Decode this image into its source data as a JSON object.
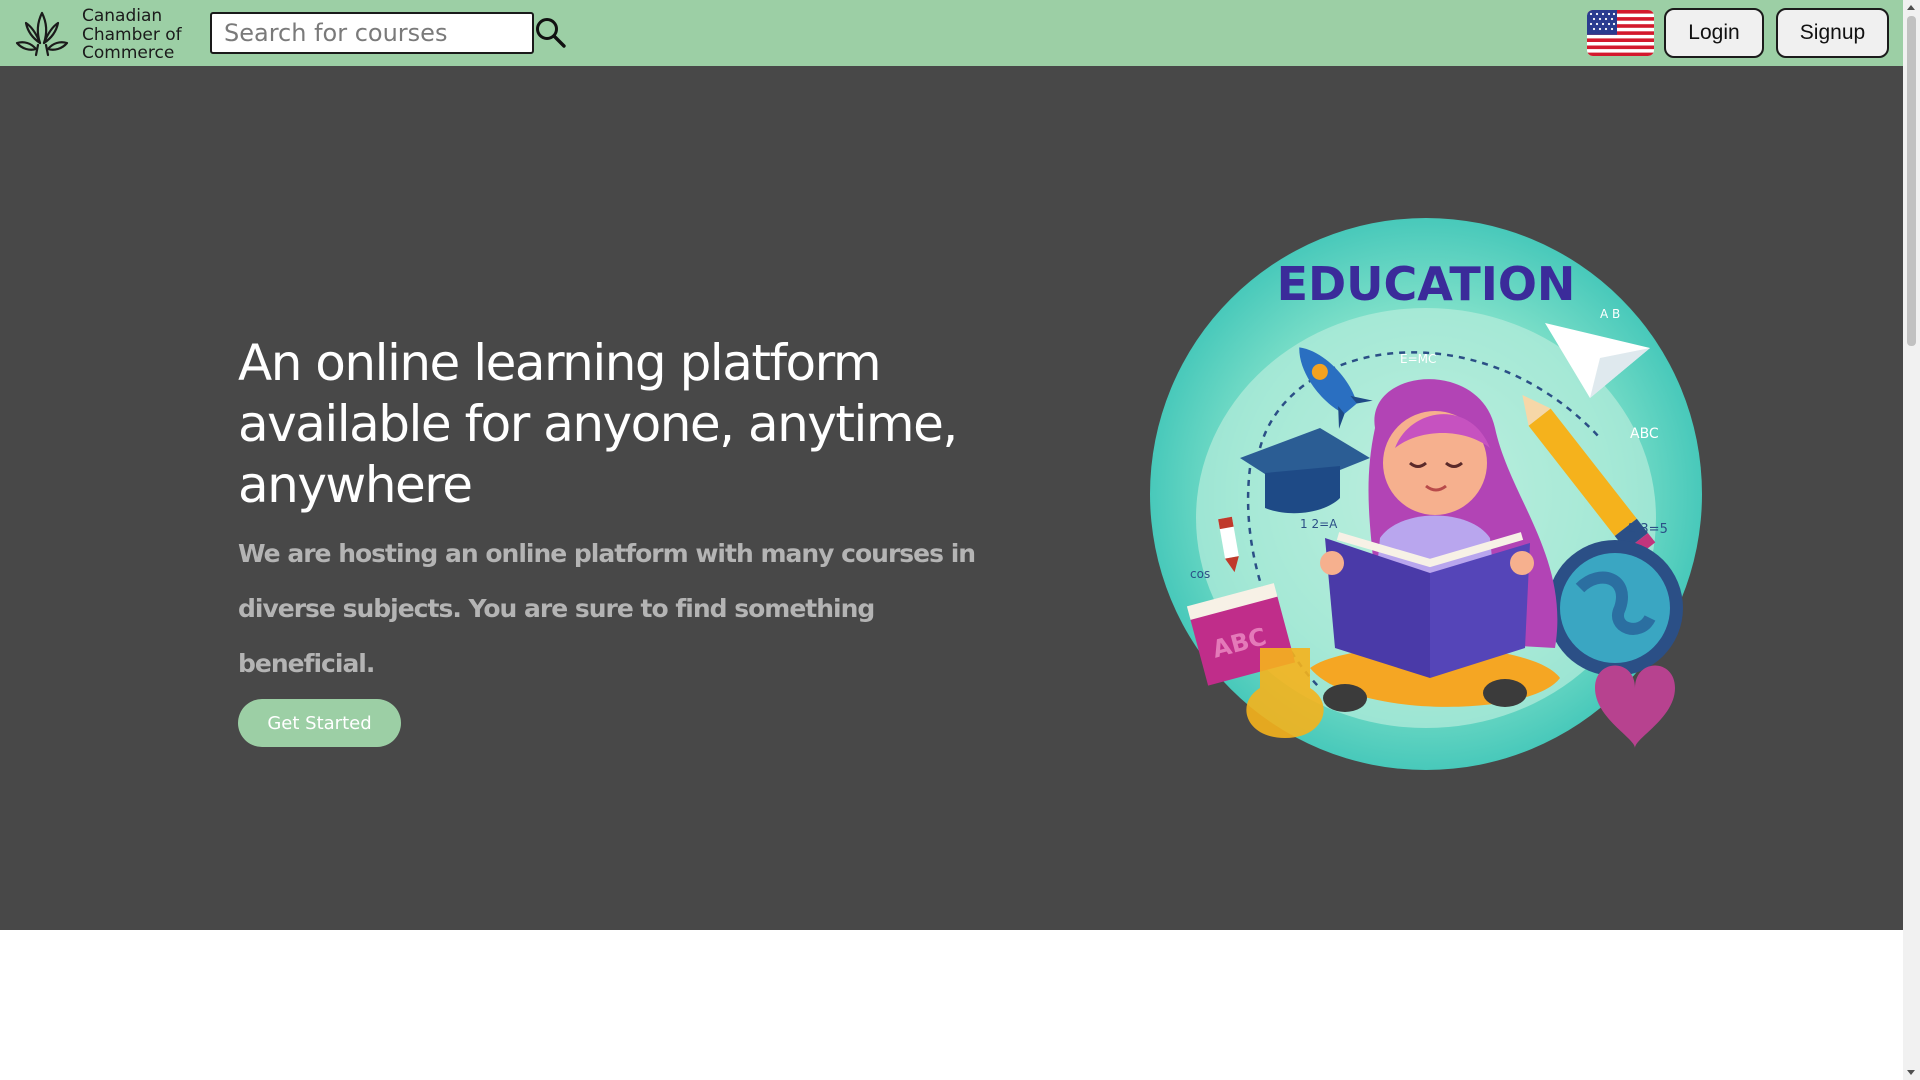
{
  "header": {
    "logo_lines": [
      "Canadian",
      "Chamber of",
      "Commerce"
    ],
    "logo_icon": "maple-leaf-icon",
    "search": {
      "placeholder": "Search for courses",
      "value": "",
      "icon": "search-icon"
    },
    "flag_icon": "us-flag-icon",
    "login_label": "Login",
    "signup_label": "Signup",
    "background_color": "#9ccfa5"
  },
  "hero": {
    "title": "An online learning platform available for anyone, anytime, anywhere",
    "subtitle": "We are hosting an online platform with many courses in diverse subjects. You are sure to find something beneficial.",
    "cta_label": "Get Started",
    "background_color": "#484848",
    "accent_color": "#9ccfa5",
    "illustration_title": "EDUCATION"
  }
}
